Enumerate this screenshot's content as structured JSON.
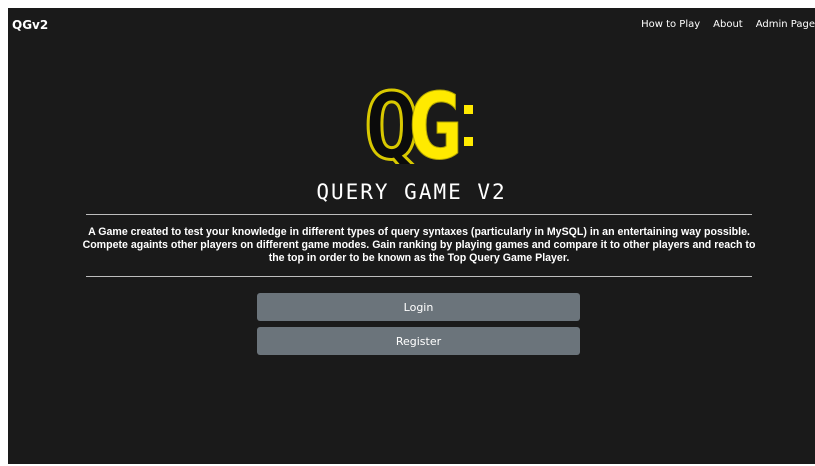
{
  "nav": {
    "brand": "QGv2",
    "links": [
      "How to Play",
      "About",
      "Admin Page"
    ]
  },
  "logo": {
    "letter_outline": "Q",
    "letter_fill": "G",
    "accent_color": "#ffea00",
    "outline_color": "#d8c800"
  },
  "hero": {
    "title": "QUERY GAME V2",
    "description": "A Game created to test your knowledge in different types of query syntaxes (particularly in MySQL) in an entertaining way possible. Compete againts other players on different game modes. Gain ranking by playing games and compare it to other players and reach to the top in order to be known as the Top Query Game Player."
  },
  "buttons": {
    "login": "Login",
    "register": "Register"
  }
}
